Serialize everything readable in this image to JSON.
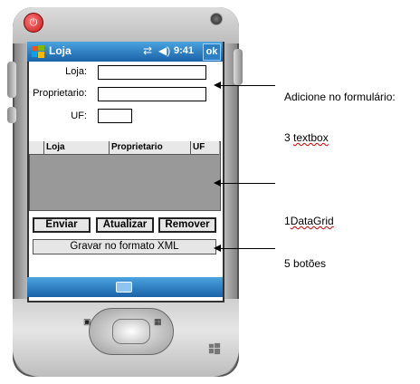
{
  "app": {
    "title": "Loja",
    "time": "9:41",
    "ok_label": "ok"
  },
  "form": {
    "loja_label": "Loja:",
    "proprietario_label": "Proprietario:",
    "uf_label": "UF:"
  },
  "grid": {
    "columns": [
      "Loja",
      "Proprietario",
      "UF"
    ]
  },
  "buttons": {
    "enviar": "Enviar",
    "atualizar": "Atualizar",
    "remover": "Remover",
    "gravar_xml": "Gravar no formato XML"
  },
  "annotations": {
    "form_note": "Adicione no formulário:",
    "textbox_count": "3",
    "textbox_word": "textbox",
    "datagrid_count": "1",
    "datagrid_word": "DataGrid",
    "buttons_count": "5",
    "buttons_word": "botões"
  },
  "colors": {
    "titlebar": "#1a62a8",
    "grid_bg": "#999999",
    "power": "#c41818"
  },
  "icons": [
    "power-icon",
    "camera-icon",
    "windows-logo-icon",
    "connectivity-icon",
    "volume-icon",
    "keyboard-icon",
    "dpad-icon",
    "softkey-left-icon",
    "softkey-right-icon",
    "start-key-icon"
  ]
}
